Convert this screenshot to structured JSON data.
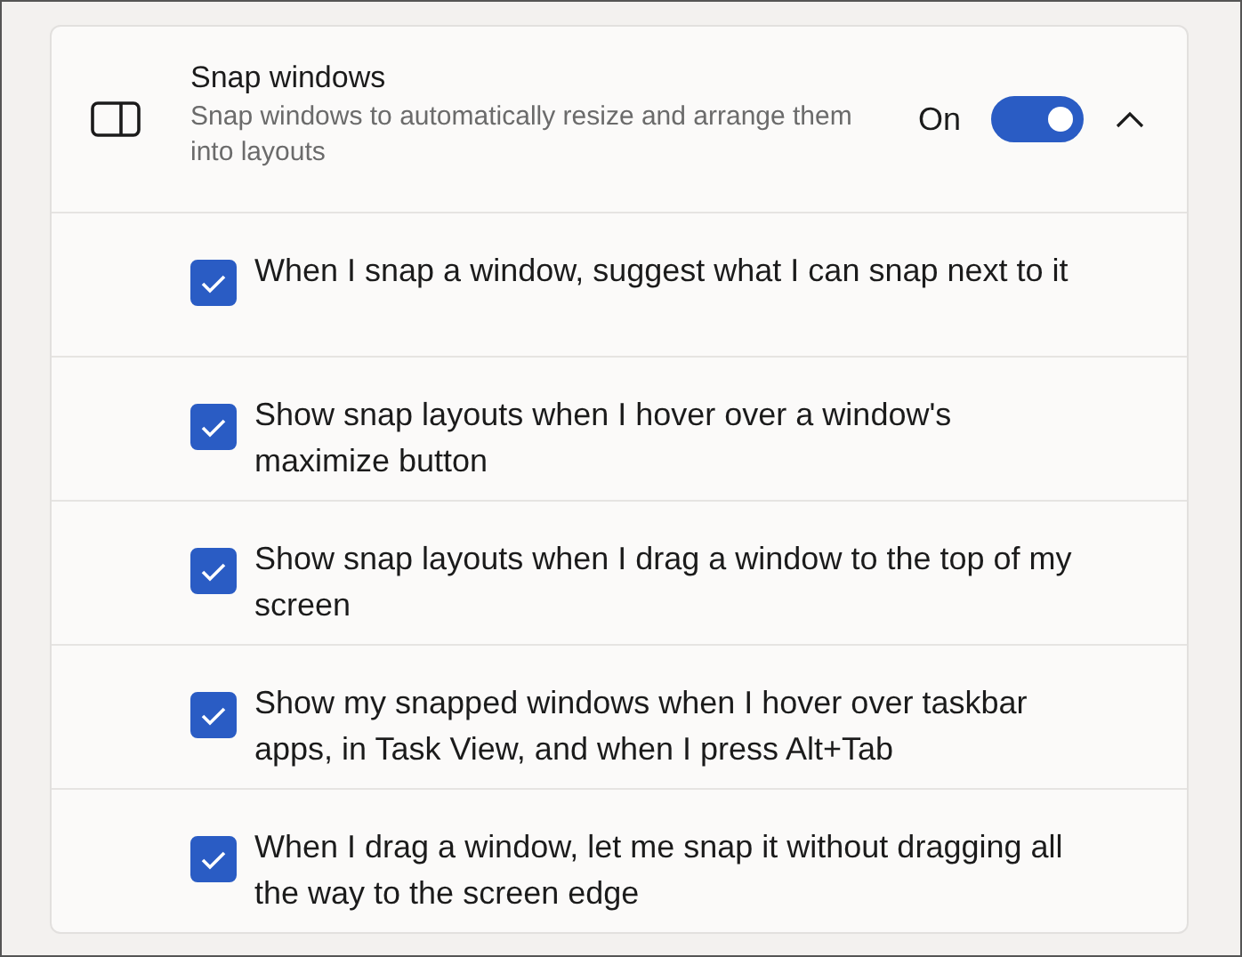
{
  "setting": {
    "title": "Snap windows",
    "description": "Snap windows to automatically resize and arrange them into layouts",
    "state_label": "On",
    "on": true,
    "expanded": true
  },
  "options": [
    {
      "label": "When I snap a window, suggest what I can snap next to it",
      "checked": true
    },
    {
      "label": "Show snap layouts when I hover over a window's maximize button",
      "checked": true
    },
    {
      "label": "Show snap layouts when I drag a window to the top of my screen",
      "checked": true
    },
    {
      "label": "Show my snapped windows when I hover over taskbar apps, in Task View, and when I press Alt+Tab",
      "checked": true
    },
    {
      "label": "When I drag a window, let me snap it without dragging all the way to the screen edge",
      "checked": true
    }
  ]
}
